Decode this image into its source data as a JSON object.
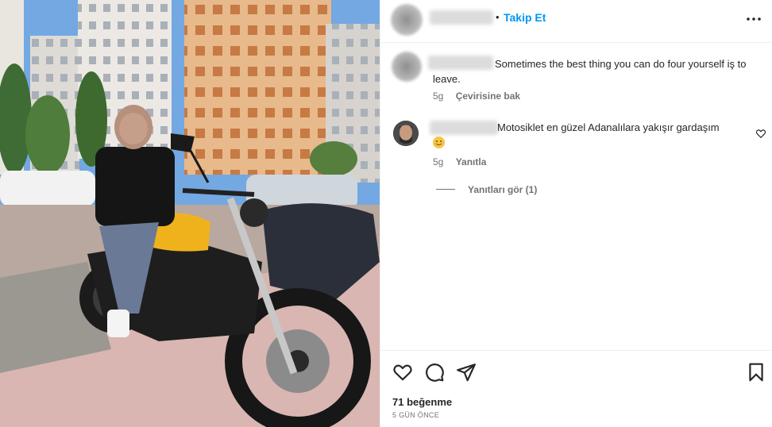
{
  "post": {
    "follow_label": "Takip Et",
    "separator": "•",
    "more_icon": "more-horizontal-icon"
  },
  "caption": {
    "text": "Sometimes the best thing you can do four yourself iş to leave.",
    "age": "5g",
    "translate_label": "Çevirisine bak"
  },
  "comment": {
    "text": "Motosiklet en güzel Adanalılara yakışır gardaşım",
    "emoji": "smiling-face-emoji",
    "age": "5g",
    "reply_label": "Yanıtla",
    "view_replies_label": "Yanıtları gör (1)",
    "like_icon": "heart-outline-icon"
  },
  "actions": {
    "icons": [
      "heart-outline-icon",
      "comment-icon",
      "share-icon",
      "bookmark-icon"
    ],
    "likes": "71 beğenme",
    "date": "5 GÜN ÖNCE"
  },
  "colors": {
    "accent": "#0095f6",
    "text": "#262626",
    "muted": "#737373",
    "border": "#efefef"
  }
}
